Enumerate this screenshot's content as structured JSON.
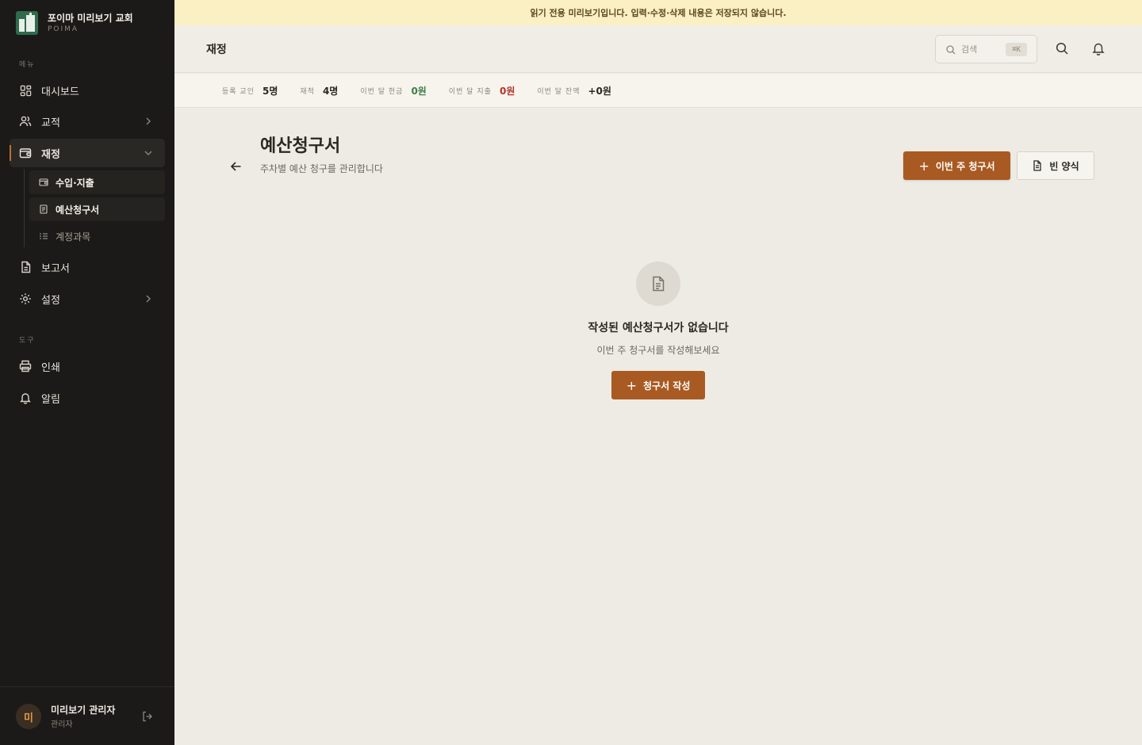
{
  "brand": {
    "name": "포이마 미리보기 교회",
    "sub": "POIMA"
  },
  "sidebar": {
    "section_menu": "메뉴",
    "section_tools": "도구",
    "items": [
      {
        "label": "대시보드",
        "icon": "grid-icon"
      },
      {
        "label": "교적",
        "icon": "users-icon"
      },
      {
        "label": "재정",
        "icon": "wallet-icon"
      },
      {
        "label": "보고서",
        "icon": "file-icon"
      },
      {
        "label": "설정",
        "icon": "gear-icon"
      }
    ],
    "finance_sub": [
      {
        "label": "수입·지출",
        "icon": "wallet-icon"
      },
      {
        "label": "예산청구서",
        "icon": "receipt-icon"
      },
      {
        "label": "계정과목",
        "icon": "list-icon"
      }
    ],
    "tools": [
      {
        "label": "인쇄",
        "icon": "printer-icon"
      },
      {
        "label": "알림",
        "icon": "bell-icon"
      }
    ]
  },
  "user": {
    "avatar": "미",
    "name": "미리보기 관리자",
    "role": "관리자"
  },
  "banner": {
    "text": "읽기 전용 미리보기입니다. 입력·수정·삭제 내용은 저장되지 않습니다."
  },
  "header": {
    "title": "재정",
    "search_placeholder": "검색",
    "shortcut": "⌘K"
  },
  "stats": [
    {
      "label": "등록 교인",
      "value": "5명",
      "tone": "default"
    },
    {
      "label": "재적",
      "value": "4명",
      "tone": "default"
    },
    {
      "label": "이번 달 헌금",
      "value": "0원",
      "tone": "green"
    },
    {
      "label": "이번 달 지출",
      "value": "0원",
      "tone": "red"
    },
    {
      "label": "이번 달 잔액",
      "value": "+0원",
      "tone": "default"
    }
  ],
  "page": {
    "title": "예산청구서",
    "subtitle": "주차별 예산 청구를 관리합니다",
    "primary_button": "이번 주 청구서",
    "secondary_button": "빈 양식",
    "empty_title": "작성된 예산청구서가 없습니다",
    "empty_subtitle": "이번 주 청구서를 작성해보세요",
    "empty_button": "청구서 작성"
  },
  "colors": {
    "accent": "#a85a22",
    "sidebar_bg": "#1b1a18",
    "banner_bg": "#fbefc4",
    "positive": "#3e7d4a",
    "negative": "#b4332c"
  }
}
